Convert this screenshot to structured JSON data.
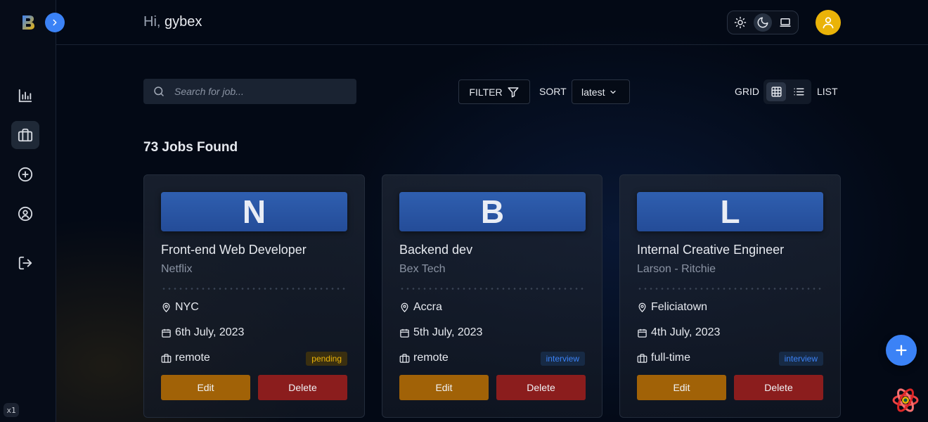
{
  "header": {
    "greeting_prefix": "Hi,",
    "username": "gybex"
  },
  "toolbar": {
    "search_placeholder": "Search for job...",
    "filter_label": "FILTER",
    "sort_label": "SORT",
    "sort_value": "latest",
    "grid_label": "GRID",
    "list_label": "LIST"
  },
  "jobs_count": "73 Jobs Found",
  "jobs": [
    {
      "initial": "N",
      "position": "Front-end Web Developer",
      "company": "Netflix",
      "location": "NYC",
      "date": "6th July, 2023",
      "type": "remote",
      "status": "pending"
    },
    {
      "initial": "B",
      "position": "Backend dev",
      "company": "Bex Tech",
      "location": "Accra",
      "date": "5th July, 2023",
      "type": "remote",
      "status": "interview"
    },
    {
      "initial": "L",
      "position": "Internal Creative Engineer",
      "company": "Larson - Ritchie",
      "location": "Feliciatown",
      "date": "4th July, 2023",
      "type": "full-time",
      "status": "interview"
    }
  ],
  "card_actions": {
    "edit_label": "Edit",
    "delete_label": "Delete"
  },
  "misc": {
    "zoom_badge": "x1"
  },
  "colors": {
    "accent": "#3b82f6",
    "avatar": "#eab308",
    "edit": "#a16207",
    "delete": "#8b1d1d",
    "pending": "#eab308",
    "interview": "#3b82f6"
  },
  "icons": {
    "sidebar": [
      "stats-icon",
      "briefcase-icon",
      "add-circle-icon",
      "profile-icon",
      "logout-icon"
    ],
    "theme": [
      "sun-icon",
      "moon-icon",
      "laptop-icon"
    ]
  }
}
